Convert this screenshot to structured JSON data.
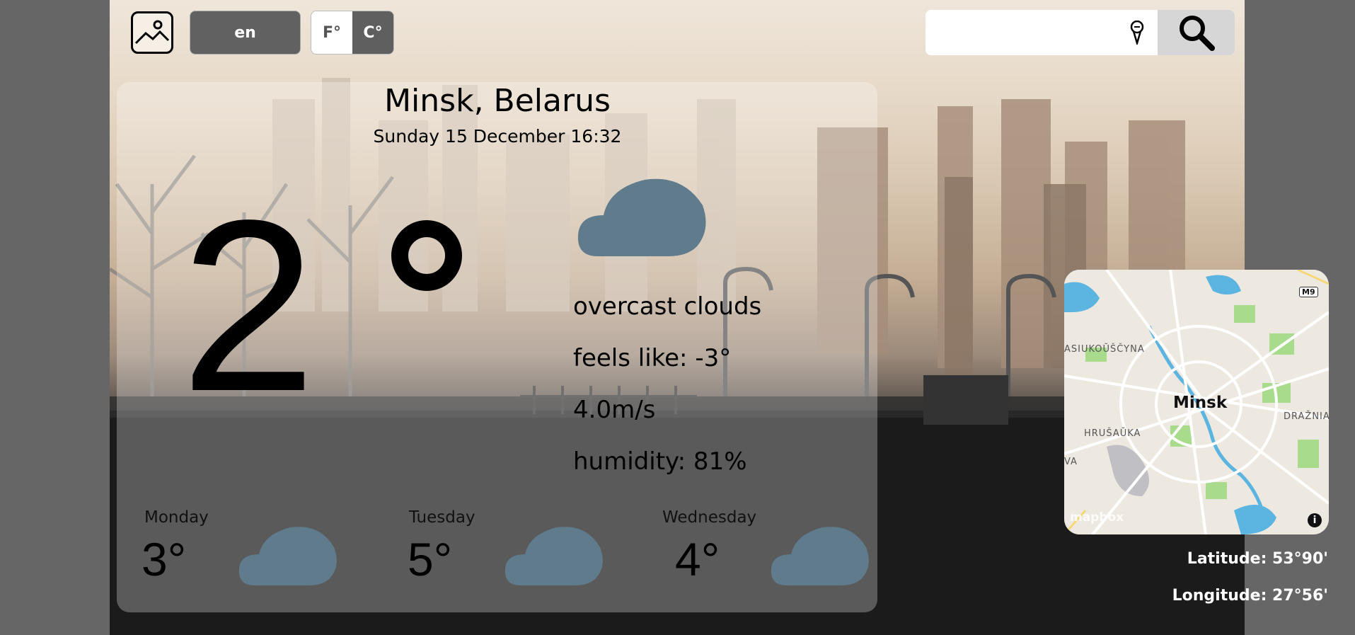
{
  "toolbar": {
    "background_icon": "image-icon",
    "language": "en",
    "unit_f": "F°",
    "unit_c": "C°",
    "active_unit": "C°"
  },
  "search": {
    "placeholder": "",
    "mic_icon": "microphone-icon",
    "search_icon": "search-icon"
  },
  "weather": {
    "city": "Minsk, Belarus",
    "datetime": "Sunday 15 December 16:32",
    "temperature": "2",
    "icon": "cloud-icon",
    "description": "overcast clouds",
    "feels_like": "feels like: -3°",
    "wind": "4.0m/s",
    "humidity": "humidity: 81%"
  },
  "forecast": [
    {
      "day": "Monday",
      "temp": "3°",
      "icon": "cloud-icon"
    },
    {
      "day": "Tuesday",
      "temp": "5°",
      "icon": "cloud-icon"
    },
    {
      "day": "Wednesday",
      "temp": "4°",
      "icon": "cloud-icon"
    }
  ],
  "map": {
    "city_label": "Minsk",
    "district_1": "ASIUKOŬŠČYNA",
    "district_2": "HRUŠAŬKA",
    "district_3": "DRAŽNIA",
    "district_4": "VA",
    "road_badge": "M9",
    "provider": "mapbox",
    "info": "i"
  },
  "coords": {
    "latitude": "Latitude: 53°90'",
    "longitude": "Longitude: 27°56'"
  },
  "colors": {
    "cloud": "#5f7b8c",
    "page_bg": "#666666",
    "button_dark": "#616161"
  }
}
